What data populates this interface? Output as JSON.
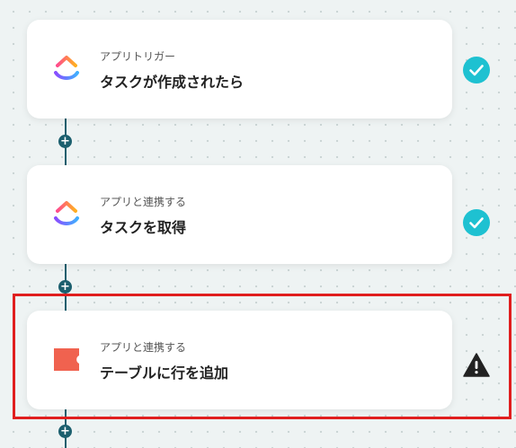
{
  "flow": {
    "steps": [
      {
        "type_label": "アプリトリガー",
        "title": "タスクが作成されたら",
        "app_icon": "clickup-icon",
        "status": "check"
      },
      {
        "type_label": "アプリと連携する",
        "title": "タスクを取得",
        "app_icon": "clickup-icon",
        "status": "check"
      },
      {
        "type_label": "アプリと連携する",
        "title": "テーブルに行を追加",
        "app_icon": "coda-icon",
        "status": "warning"
      }
    ],
    "add_symbol": "+"
  },
  "colors": {
    "connector": "#1c5f6e",
    "check": "#1ec1d1",
    "warning": "#222222",
    "highlight": "#e01e1e",
    "coda": "#f0624f"
  }
}
